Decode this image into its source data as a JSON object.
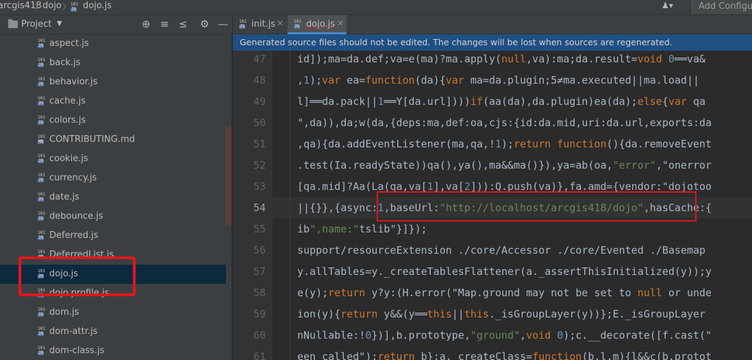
{
  "breadcrumb": {
    "project": "arcgis418",
    "folder": "dojo",
    "file": "dojo.js"
  },
  "toolbar": {
    "user_icon": "user-icon",
    "add_configuration": "Add Configur"
  },
  "project_panel": {
    "title": "Project",
    "tools": [
      "locate-icon",
      "collapse-all-icon",
      "expand-all-icon",
      "gear-icon",
      "minimize-icon"
    ],
    "files": [
      {
        "name": "aspect.js",
        "type": "js"
      },
      {
        "name": "back.js",
        "type": "js"
      },
      {
        "name": "behavior.js",
        "type": "js"
      },
      {
        "name": "cache.js",
        "type": "js"
      },
      {
        "name": "colors.js",
        "type": "js"
      },
      {
        "name": "CONTRIBUTING.md",
        "type": "md"
      },
      {
        "name": "cookie.js",
        "type": "js"
      },
      {
        "name": "currency.js",
        "type": "js"
      },
      {
        "name": "date.js",
        "type": "js"
      },
      {
        "name": "debounce.js",
        "type": "js"
      },
      {
        "name": "Deferred.js",
        "type": "js"
      },
      {
        "name": "DeferredList.js",
        "type": "js"
      },
      {
        "name": "dojo.js",
        "type": "js",
        "selected": true
      },
      {
        "name": "dojo.profile.js",
        "type": "js"
      },
      {
        "name": "dom.js",
        "type": "js"
      },
      {
        "name": "dom-attr.js",
        "type": "js"
      },
      {
        "name": "dom-class.js",
        "type": "js"
      }
    ]
  },
  "tabs": [
    {
      "label": "init.js",
      "active": false
    },
    {
      "label": "dojo.js",
      "active": true
    }
  ],
  "notification": "Generated source files should not be edited. The changes will be lost when sources are regenerated.",
  "editor": {
    "current_line": 54,
    "lines": [
      {
        "no": "47",
        "text": "id]);ma=da.def;va=e(ma)?ma.apply(null,va):ma;da.result=void 0══va&"
      },
      {
        "no": "48",
        "text": ",1);var ea=function(da){var ma=da.plugin;5≠ma.executed||ma.load||"
      },
      {
        "no": "49",
        "text": "l]══da.pack||1══Y[da.url])))if(aa(da),da.plugin)ea(da);else{var qa"
      },
      {
        "no": "50",
        "text": "\",da)),da;w(da,{deps:ma,def:oa,cjs:{id:da.mid,uri:da.url,exports:da"
      },
      {
        "no": "51",
        "text": ",qa){da.addEventListener(ma,qa,!1);return function(){da.removeEvent"
      },
      {
        "no": "52",
        "text": ".test(Ia.readyState))qa(),ya(),ma&&ma()}),ya=ab(oa,\"error\",\"onerror"
      },
      {
        "no": "53",
        "text": "[qa.mid]?Aa(La(qa,va[1],va[2])):Q.push(va)},fa.amd={vendor:\"dojotoo"
      },
      {
        "no": "54",
        "text": "||{}},{async:1,baseUrl:\"http://localhost/arcgis418/dojo\",hasCache:{"
      },
      {
        "no": "55",
        "text": "ib\",name:\"tslib\"}]});"
      },
      {
        "no": "56",
        "text": "support/resourceExtension ./core/Accessor ./core/Evented ./Basemap"
      },
      {
        "no": "57",
        "text": "y.allTables=y._createTablesFlattener(a._assertThisInitialized(y));y"
      },
      {
        "no": "58",
        "text": "e(y);return y?y:(H.error(\"Map.ground may not be set to null or unde"
      },
      {
        "no": "59",
        "text": "ion(y){return y&&(y══this||this._isGroupLayer(y))};E._isGroupLayer"
      },
      {
        "no": "60",
        "text": "nNullable:!0})],b.prototype,\"ground\",void 0);c.__decorate([f.cast(\""
      },
      {
        "no": "61",
        "text": "een called\");return b};a._createClass=function(b,l,m){l&&c(b.protot"
      }
    ]
  },
  "colors": {
    "panel": "#3c3f41",
    "editor": "#2b2b2b",
    "selection": "#0d293e",
    "notice": "#1f4f83",
    "highlight": "#e0161d",
    "keyword": "#cc7832",
    "string": "#6a8759",
    "number": "#6897bb"
  }
}
